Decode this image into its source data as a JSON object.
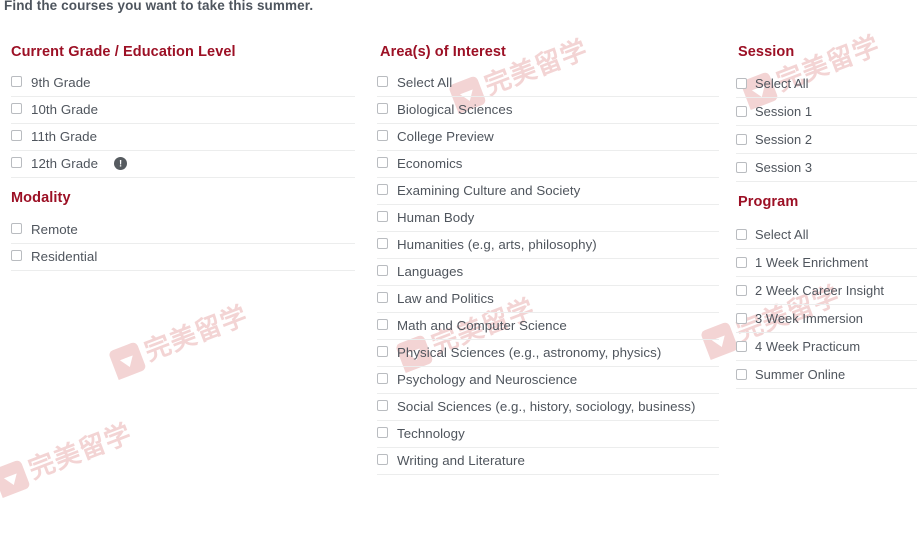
{
  "intro_text": "Find the courses you want to take this summer.",
  "theme": {
    "heading_color": "#9c1025",
    "label_color": "#4f555d",
    "divider_color": "#eceded",
    "checkbox_border": "#b9bcc0",
    "info_icon_bg": "#565b60",
    "watermark_color": "#f3d4d4",
    "background": "#ffffff"
  },
  "watermark": {
    "text": "完美留学",
    "logo_icon": "watermark-logo-icon"
  },
  "columns": {
    "left": {
      "groups": [
        {
          "title": "Current Grade / Education Level",
          "options": [
            {
              "label": "9th Grade",
              "checked": false
            },
            {
              "label": "10th Grade",
              "checked": false
            },
            {
              "label": "11th Grade",
              "checked": false
            },
            {
              "label": "12th Grade",
              "checked": false,
              "info": "info-icon"
            }
          ]
        },
        {
          "title": "Modality",
          "options": [
            {
              "label": "Remote",
              "checked": false
            },
            {
              "label": "Residential",
              "checked": false
            }
          ]
        }
      ]
    },
    "middle": {
      "groups": [
        {
          "title": "Area(s) of Interest",
          "options": [
            {
              "label": "Select All",
              "checked": false
            },
            {
              "label": "Biological Sciences",
              "checked": false
            },
            {
              "label": "College Preview",
              "checked": false
            },
            {
              "label": "Economics",
              "checked": false
            },
            {
              "label": "Examining Culture and Society",
              "checked": false
            },
            {
              "label": "Human Body",
              "checked": false
            },
            {
              "label": "Humanities (e.g, arts, philosophy)",
              "checked": false
            },
            {
              "label": "Languages",
              "checked": false
            },
            {
              "label": "Law and Politics",
              "checked": false
            },
            {
              "label": "Math and Computer Science",
              "checked": false
            },
            {
              "label": "Physical Sciences (e.g., astronomy, physics)",
              "checked": false
            },
            {
              "label": "Psychology and Neuroscience",
              "checked": false
            },
            {
              "label": "Social Sciences (e.g., history, sociology, business)",
              "checked": false
            },
            {
              "label": "Technology",
              "checked": false
            },
            {
              "label": "Writing and Literature",
              "checked": false
            }
          ]
        }
      ]
    },
    "right": {
      "groups": [
        {
          "title": "Session",
          "options": [
            {
              "label": "Select All",
              "checked": false
            },
            {
              "label": "Session 1",
              "checked": false
            },
            {
              "label": "Session 2",
              "checked": false
            },
            {
              "label": "Session 3",
              "checked": false
            }
          ]
        },
        {
          "title": "Program",
          "options": [
            {
              "label": "Select All",
              "checked": false
            },
            {
              "label": "1 Week Enrichment",
              "checked": false
            },
            {
              "label": "2 Week Career Insight",
              "checked": false
            },
            {
              "label": "3 Week Immersion",
              "checked": false
            },
            {
              "label": "4 Week Practicum",
              "checked": false
            },
            {
              "label": "Summer Online",
              "checked": false
            }
          ]
        }
      ]
    }
  }
}
